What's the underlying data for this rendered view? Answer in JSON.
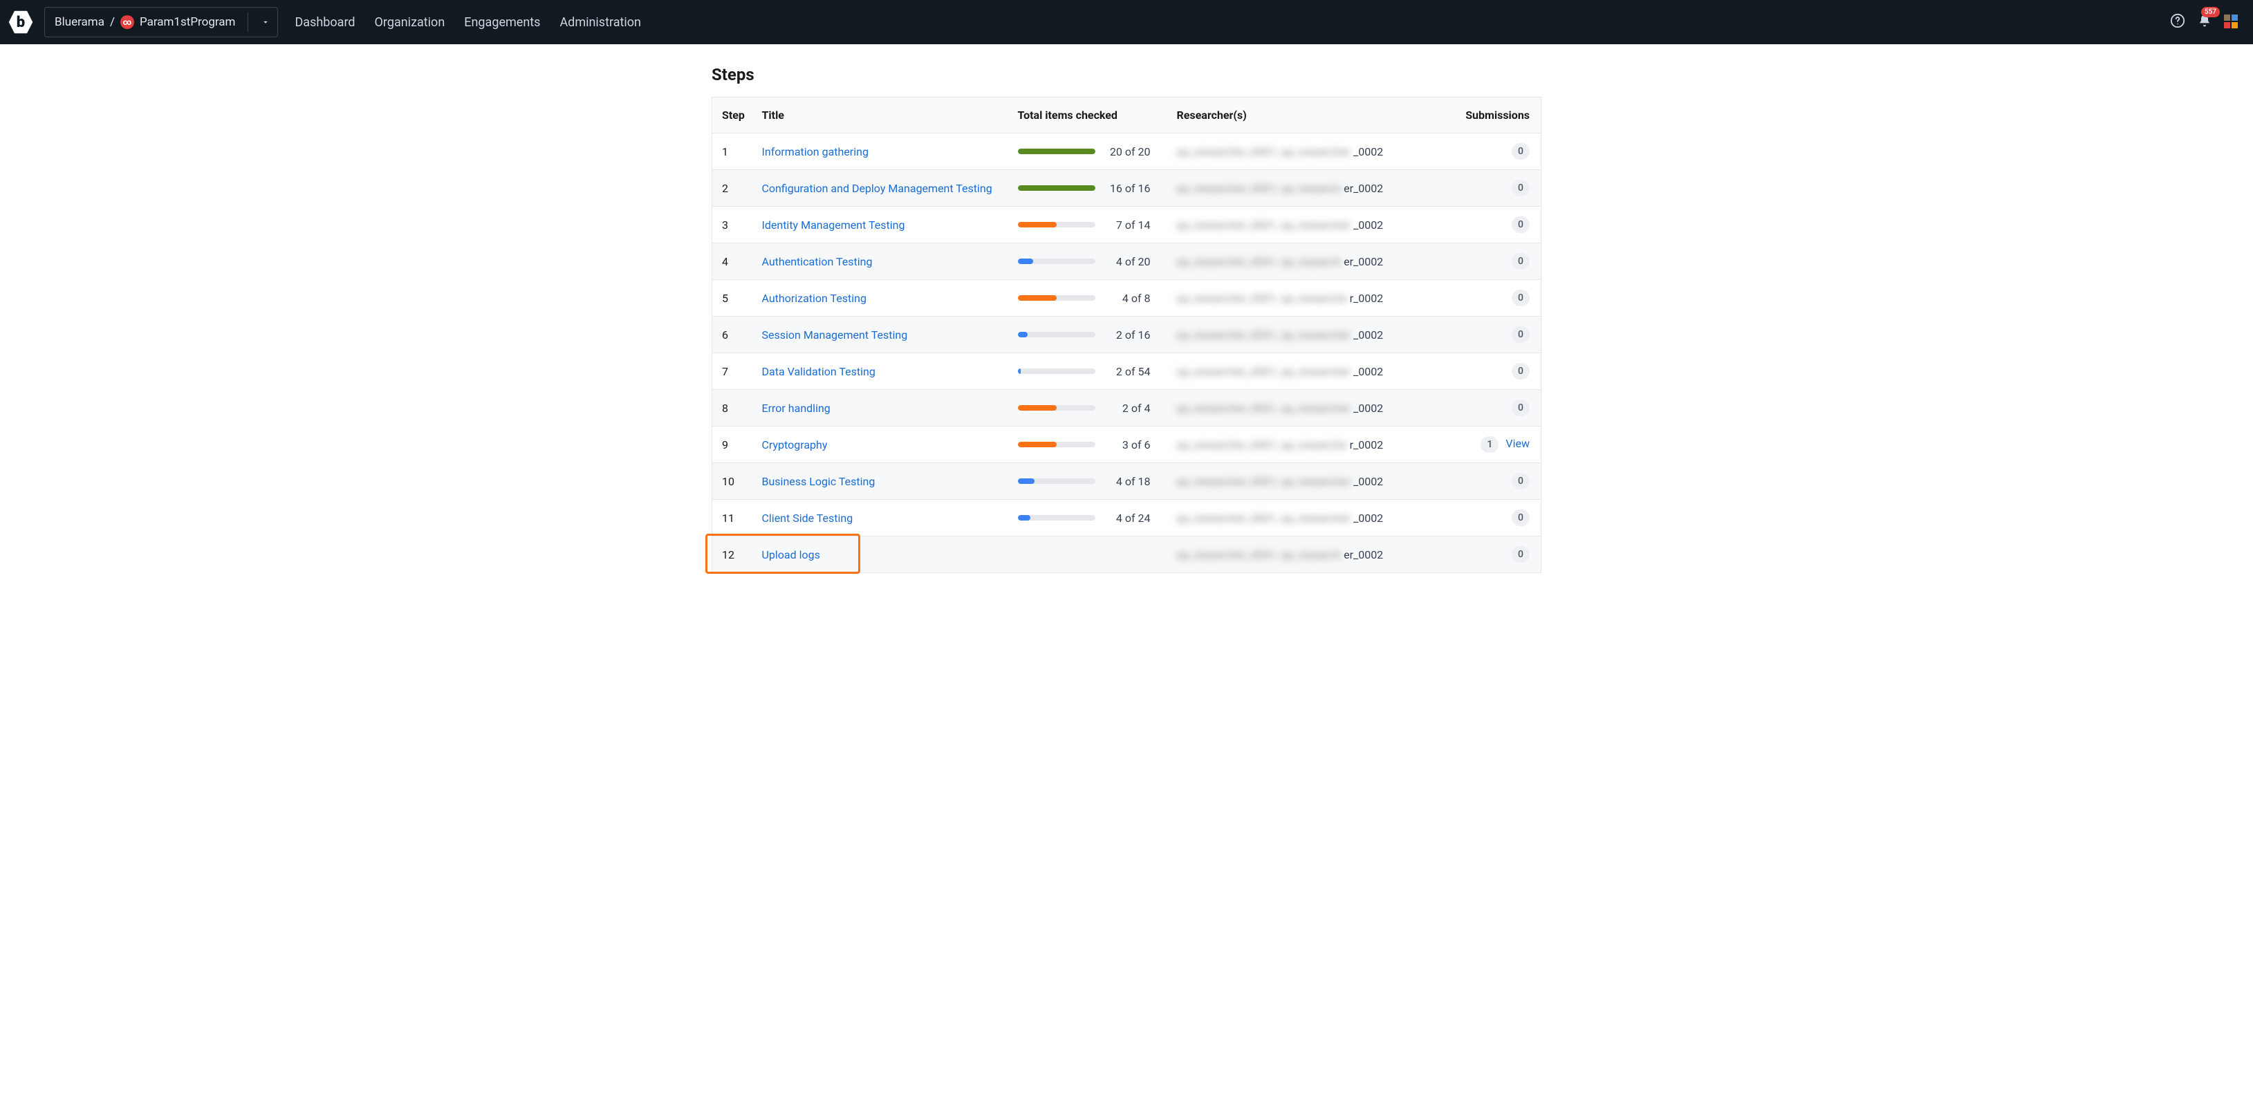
{
  "nav": {
    "breadcrumb_org": "Bluerama",
    "breadcrumb_sep": "/",
    "breadcrumb_program": "Param1stProgram",
    "links": [
      "Dashboard",
      "Organization",
      "Engagements",
      "Administration"
    ],
    "badge_count": "557"
  },
  "heading": "Steps",
  "columns": {
    "step": "Step",
    "title": "Title",
    "items": "Total items checked",
    "researchers": "Researcher(s)",
    "submissions": "Submissions"
  },
  "progress_colors": {
    "green": "#5a8a1f",
    "orange": "#f97316",
    "blue": "#3b82f6"
  },
  "rows": [
    {
      "step": "1",
      "title": "Information gathering",
      "done": 20,
      "total": 20,
      "color": "green",
      "researcher_blur": "qa_researcher_0001, qa_researcher",
      "researcher_clear": "_0002",
      "subs": "0",
      "view": false,
      "highlight": false
    },
    {
      "step": "2",
      "title": "Configuration and Deploy Management Testing",
      "done": 16,
      "total": 16,
      "color": "green",
      "researcher_blur": "qa_researcher_0001, qa_research",
      "researcher_clear": "er_0002",
      "subs": "0",
      "view": false,
      "highlight": false
    },
    {
      "step": "3",
      "title": "Identity Management Testing",
      "done": 7,
      "total": 14,
      "color": "orange",
      "researcher_blur": "qa_researcher_0001, qa_researcher",
      "researcher_clear": "_0002",
      "subs": "0",
      "view": false,
      "highlight": false
    },
    {
      "step": "4",
      "title": "Authentication Testing",
      "done": 4,
      "total": 20,
      "color": "blue",
      "researcher_blur": "qa_researcher_0001, qa_research",
      "researcher_clear": "er_0002",
      "subs": "0",
      "view": false,
      "highlight": false
    },
    {
      "step": "5",
      "title": "Authorization Testing",
      "done": 4,
      "total": 8,
      "color": "orange",
      "researcher_blur": "qa_researcher_0001, qa_researche",
      "researcher_clear": "r_0002",
      "subs": "0",
      "view": false,
      "highlight": false
    },
    {
      "step": "6",
      "title": "Session Management Testing",
      "done": 2,
      "total": 16,
      "color": "blue",
      "researcher_blur": "qa_researcher_0001, qa_researcher",
      "researcher_clear": "_0002",
      "subs": "0",
      "view": false,
      "highlight": false
    },
    {
      "step": "7",
      "title": "Data Validation Testing",
      "done": 2,
      "total": 54,
      "color": "blue",
      "researcher_blur": "qa_researcher_0001, qa_researcher",
      "researcher_clear": "_0002",
      "subs": "0",
      "view": false,
      "highlight": false
    },
    {
      "step": "8",
      "title": "Error handling",
      "done": 2,
      "total": 4,
      "color": "orange",
      "researcher_blur": "qa_researcher_0001, qa_researcher",
      "researcher_clear": "_0002",
      "subs": "0",
      "view": false,
      "highlight": false
    },
    {
      "step": "9",
      "title": "Cryptography",
      "done": 3,
      "total": 6,
      "color": "orange",
      "researcher_blur": "qa_researcher_0001, qa_researche",
      "researcher_clear": "r_0002",
      "subs": "1",
      "view": true,
      "highlight": false
    },
    {
      "step": "10",
      "title": "Business Logic Testing",
      "done": 4,
      "total": 18,
      "color": "blue",
      "researcher_blur": "qa_researcher_0001, qa_researcher",
      "researcher_clear": "_0002",
      "subs": "0",
      "view": false,
      "highlight": false
    },
    {
      "step": "11",
      "title": "Client Side Testing",
      "done": 4,
      "total": 24,
      "color": "blue",
      "researcher_blur": "qa_researcher_0001, qa_researcher",
      "researcher_clear": "_0002",
      "subs": "0",
      "view": false,
      "highlight": false
    },
    {
      "step": "12",
      "title": "Upload logs",
      "done": null,
      "total": null,
      "color": null,
      "researcher_blur": "qa_researcher_0001, qa_research",
      "researcher_clear": "er_0002",
      "subs": "0",
      "view": false,
      "highlight": true
    }
  ],
  "view_label": "View"
}
